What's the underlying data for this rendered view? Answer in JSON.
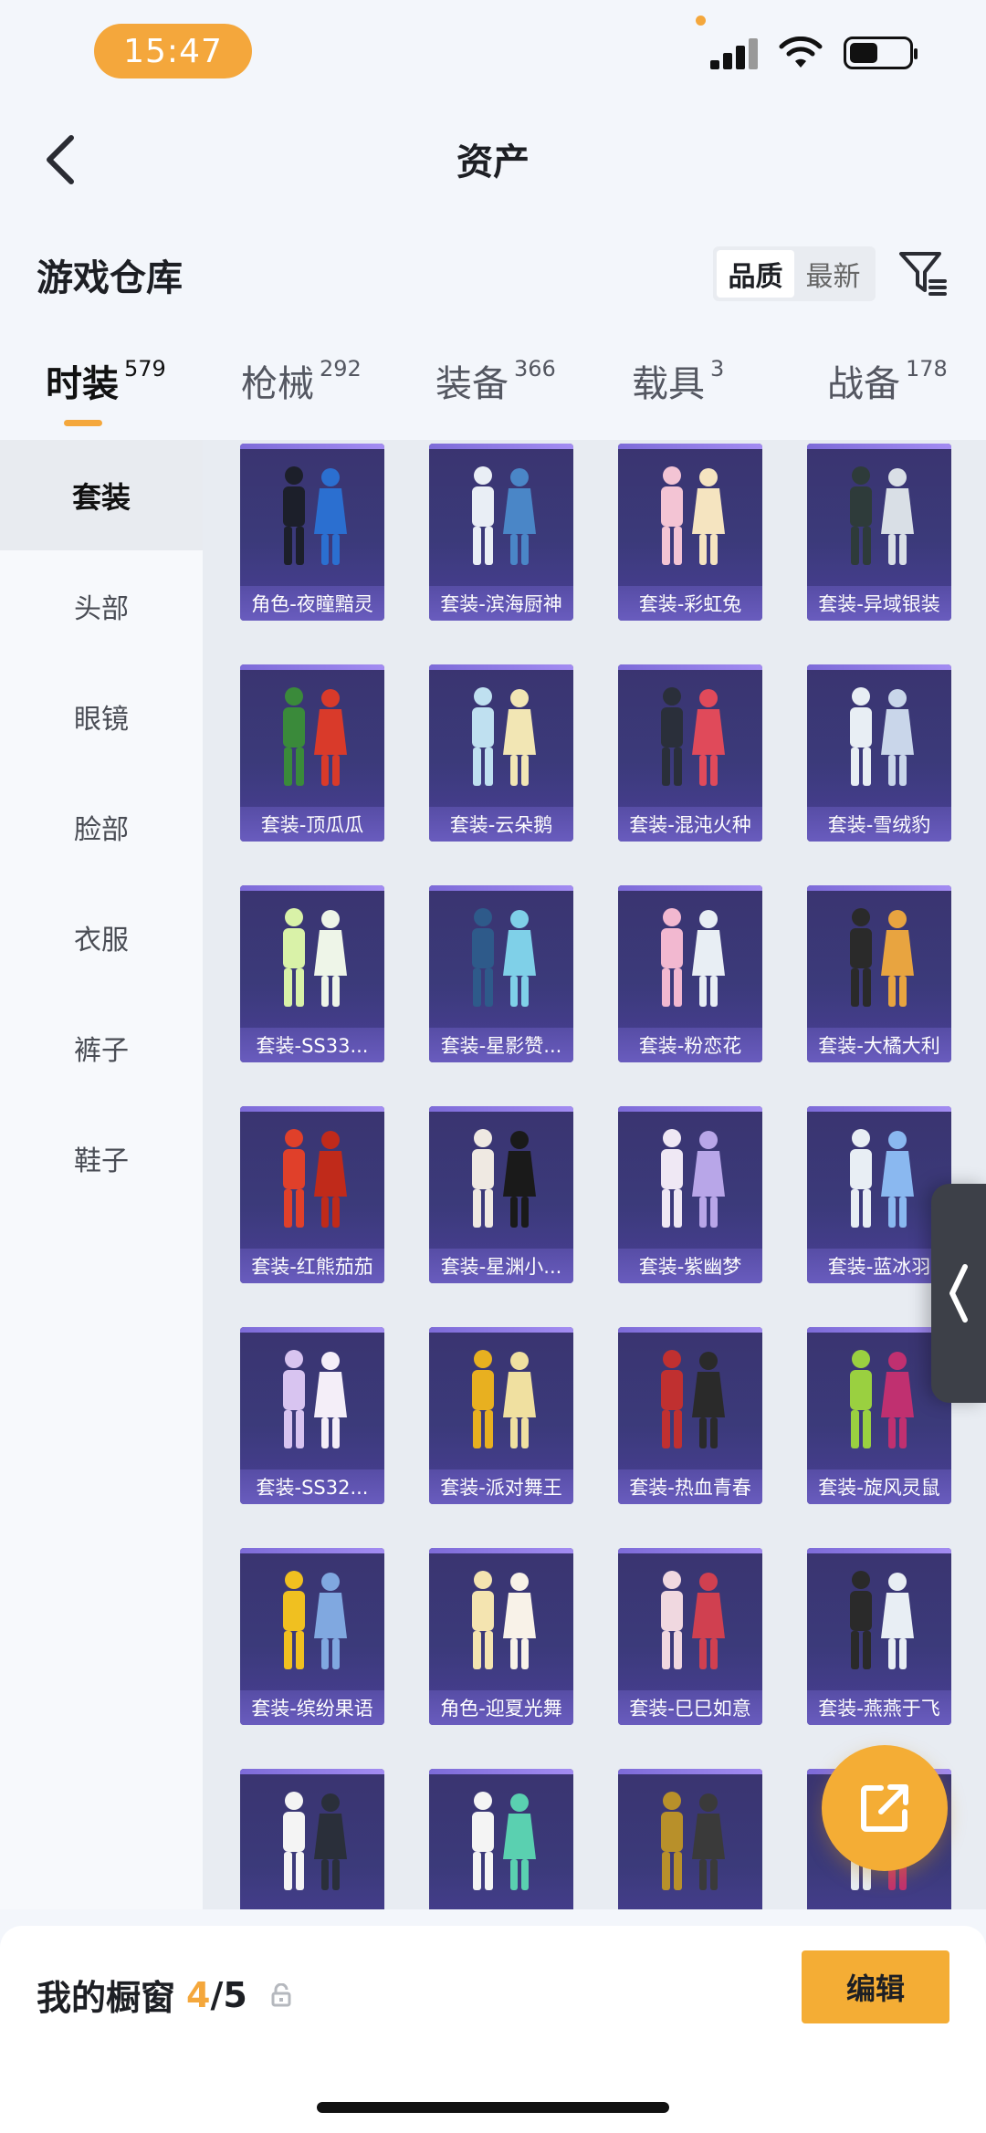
{
  "status_bar": {
    "time": "15:47"
  },
  "header": {
    "title": "资产"
  },
  "section": {
    "title": "游戏仓库"
  },
  "sort": {
    "options": [
      "品质",
      "最新"
    ],
    "active": 0
  },
  "tabs": [
    {
      "label": "时装",
      "count": "579",
      "active": true
    },
    {
      "label": "枪械",
      "count": "292"
    },
    {
      "label": "装备",
      "count": "366"
    },
    {
      "label": "载具",
      "count": "3"
    },
    {
      "label": "战备",
      "count": "178"
    }
  ],
  "sidebar": {
    "items": [
      {
        "label": "套装",
        "active": true
      },
      {
        "label": "头部"
      },
      {
        "label": "眼镜"
      },
      {
        "label": "脸部"
      },
      {
        "label": "衣服"
      },
      {
        "label": "裤子"
      },
      {
        "label": "鞋子"
      }
    ]
  },
  "grid": {
    "items": [
      {
        "label": "角色-夜瞳黯灵",
        "palette": [
          "#1c1f2a",
          "#2b6fd0"
        ]
      },
      {
        "label": "套装-滨海厨神",
        "palette": [
          "#e9eef5",
          "#4a86c7"
        ]
      },
      {
        "label": "套装-彩虹兔",
        "palette": [
          "#f3c4d4",
          "#f5e4c0"
        ]
      },
      {
        "label": "套装-异域银装",
        "palette": [
          "#2e3b3a",
          "#d9dfe6"
        ]
      },
      {
        "label": "套装-顶瓜瓜",
        "palette": [
          "#3a8a3a",
          "#d93a2a"
        ]
      },
      {
        "label": "套装-云朵鹅",
        "palette": [
          "#bfe0f0",
          "#f2e6b4"
        ]
      },
      {
        "label": "套装-混沌火种",
        "palette": [
          "#2a2f3a",
          "#e04a5a"
        ]
      },
      {
        "label": "套装-雪绒豹",
        "palette": [
          "#e8eef4",
          "#c9d6ea"
        ]
      },
      {
        "label": "套装-SS33...",
        "palette": [
          "#d9f2a8",
          "#eef5e8"
        ]
      },
      {
        "label": "套装-星影赞...",
        "palette": [
          "#2e5a8a",
          "#7fd0e8"
        ]
      },
      {
        "label": "套装-粉恋花",
        "palette": [
          "#f2b8d0",
          "#e8eef4"
        ]
      },
      {
        "label": "套装-大橘大利",
        "palette": [
          "#2a2a2a",
          "#e8a440"
        ]
      },
      {
        "label": "套装-红熊茄茄",
        "palette": [
          "#e0402a",
          "#c02a1a"
        ]
      },
      {
        "label": "套装-星渊小...",
        "palette": [
          "#efe9e2",
          "#1a1a1a"
        ]
      },
      {
        "label": "套装-紫幽梦",
        "palette": [
          "#efe8f4",
          "#b8a6e8"
        ]
      },
      {
        "label": "套装-蓝冰羽",
        "palette": [
          "#e8eef4",
          "#8ab8f0"
        ]
      },
      {
        "label": "套装-SS32...",
        "palette": [
          "#d8c4f0",
          "#f4eef8"
        ]
      },
      {
        "label": "套装-派对舞王",
        "palette": [
          "#e8b020",
          "#f0e0a0"
        ]
      },
      {
        "label": "套装-热血青春",
        "palette": [
          "#c03030",
          "#2a2a2a"
        ]
      },
      {
        "label": "套装-旋风灵鼠",
        "palette": [
          "#9ad040",
          "#c03070"
        ]
      },
      {
        "label": "套装-缤纷果语",
        "palette": [
          "#f0c020",
          "#80a8e0"
        ]
      },
      {
        "label": "角色-迎夏光舞",
        "palette": [
          "#f4e4b0",
          "#f8f2e8"
        ]
      },
      {
        "label": "套装-巳巳如意",
        "palette": [
          "#f0d8e0",
          "#d04050"
        ]
      },
      {
        "label": "套装-燕燕于飞",
        "palette": [
          "#2a2a2a",
          "#e8eef4"
        ]
      },
      {
        "label": "",
        "palette": [
          "#f4f4f4",
          "#2a2f3a"
        ]
      },
      {
        "label": "",
        "palette": [
          "#f4f4f4",
          "#5ad0b0"
        ]
      },
      {
        "label": "",
        "palette": [
          "#b8902a",
          "#3a3a3a"
        ]
      },
      {
        "label": "",
        "palette": [
          "#e8eef4",
          "#c03070"
        ]
      }
    ]
  },
  "footer": {
    "showcase_label": "我的橱窗",
    "showcase_current": "4",
    "showcase_total": "/5",
    "edit_label": "编辑"
  }
}
